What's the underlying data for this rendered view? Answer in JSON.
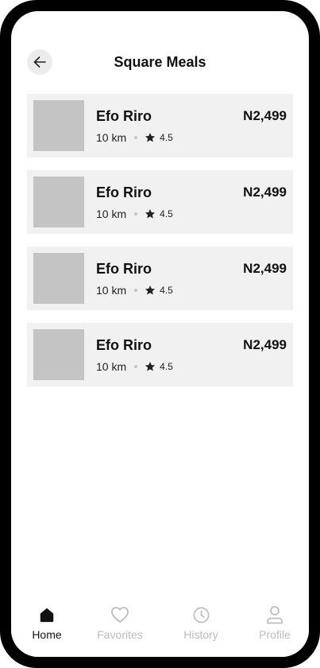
{
  "header": {
    "title": "Square Meals",
    "back_icon": "arrow-left-icon"
  },
  "meals": [
    {
      "name": "Efo Riro",
      "price": "N2,499",
      "distance": "10 km",
      "rating": "4.5"
    },
    {
      "name": "Efo Riro",
      "price": "N2,499",
      "distance": "10 km",
      "rating": "4.5"
    },
    {
      "name": "Efo Riro",
      "price": "N2,499",
      "distance": "10 km",
      "rating": "4.5"
    },
    {
      "name": "Efo Riro",
      "price": "N2,499",
      "distance": "10 km",
      "rating": "4.5"
    }
  ],
  "nav": {
    "items": [
      {
        "label": "Home",
        "icon": "home-icon",
        "active": true
      },
      {
        "label": "Favorites",
        "icon": "heart-icon",
        "active": false
      },
      {
        "label": "History",
        "icon": "clock-icon",
        "active": false
      },
      {
        "label": "Profile",
        "icon": "user-icon",
        "active": false
      }
    ]
  },
  "colors": {
    "card_background": "#f1f1f1",
    "thumbnail_placeholder": "#c4c4c4",
    "nav_active": "#111111",
    "nav_inactive": "#bdbdbd"
  }
}
